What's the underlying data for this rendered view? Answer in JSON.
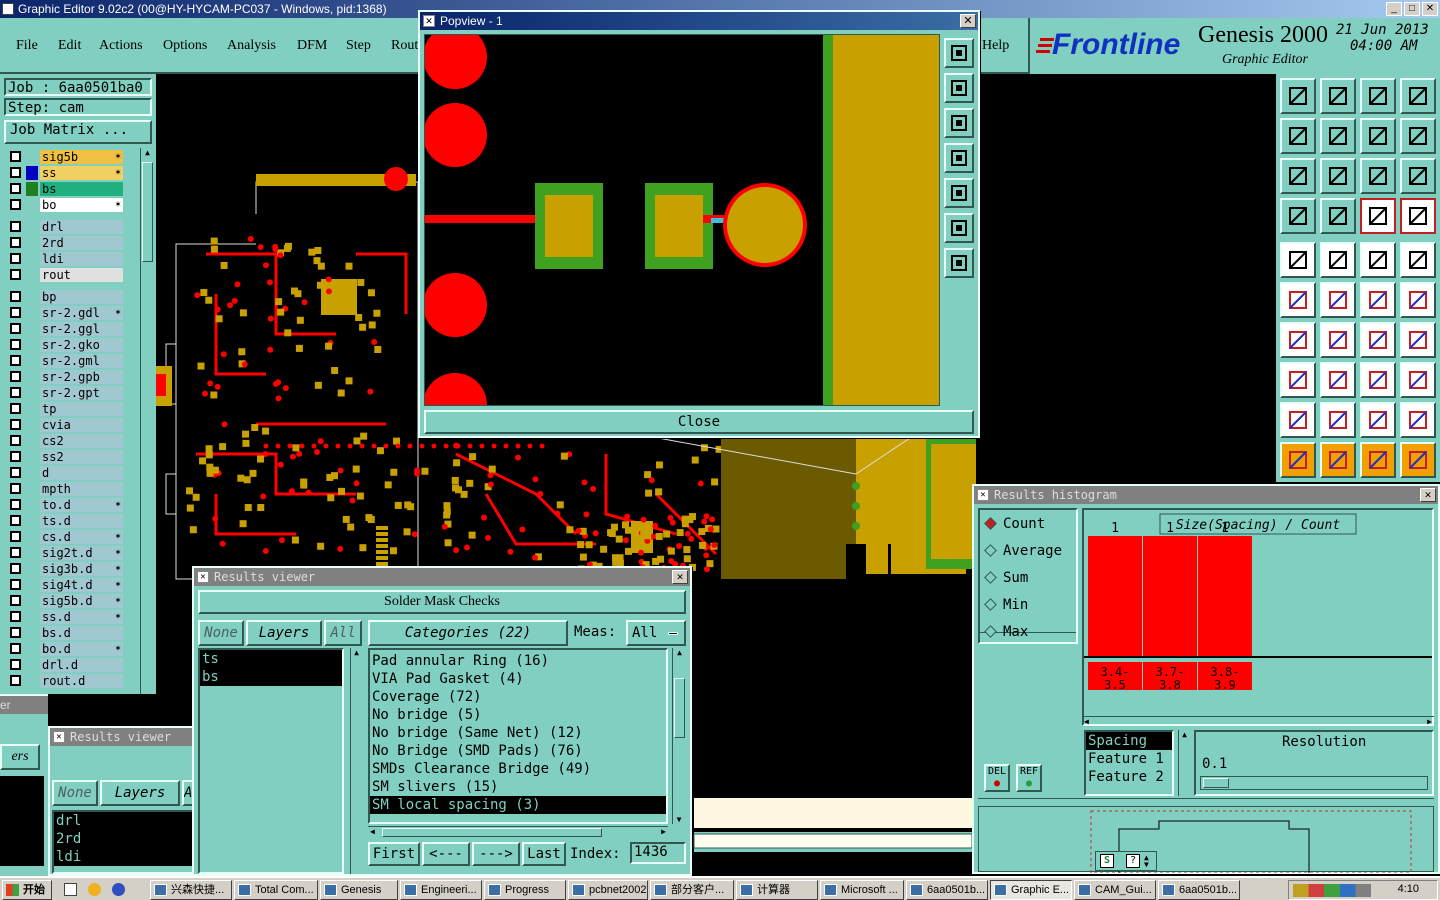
{
  "window": {
    "title": "Graphic Editor 9.02c2 (00@HY-HYCAM-PC037 - Windows, pid:1368)"
  },
  "menu": [
    "File",
    "Edit",
    "Actions",
    "Options",
    "Analysis",
    "DFM",
    "Step",
    "Rout"
  ],
  "menu_help": "Help",
  "brand": {
    "company": "Frontline",
    "product": "Genesis 2000",
    "subtitle": "Graphic Editor",
    "date": "21 Jun 2013",
    "time": "04:00 AM"
  },
  "job": {
    "job_label": "Job : 6aa0501ba0",
    "step_label": "Step: cam",
    "matrix_button": "Job Matrix ..."
  },
  "layers": [
    {
      "name": "sig5b",
      "color": "#f0c040",
      "mark": "✶"
    },
    {
      "name": "ss",
      "color": "#f0d060",
      "mark": "✶"
    },
    {
      "name": "bs",
      "color": "#20b080",
      "mark": ""
    },
    {
      "name": "bo",
      "color": "#ffffff",
      "mark": "✶"
    },
    {
      "name": "drl",
      "color": "#a0c8d0",
      "mark": ""
    },
    {
      "name": "2rd",
      "color": "#a0c8d0",
      "mark": ""
    },
    {
      "name": "ldi",
      "color": "#a0c8d0",
      "mark": ""
    },
    {
      "name": "rout",
      "color": "#e0e0e0",
      "mark": ""
    },
    {
      "name": "bp",
      "color": "#a0c8d0",
      "mark": ""
    },
    {
      "name": "sr-2.gdl",
      "color": "#a0c8d0",
      "mark": "✶"
    },
    {
      "name": "sr-2.ggl",
      "color": "#a0c8d0",
      "mark": ""
    },
    {
      "name": "sr-2.gko",
      "color": "#a0c8d0",
      "mark": ""
    },
    {
      "name": "sr-2.gml",
      "color": "#a0c8d0",
      "mark": ""
    },
    {
      "name": "sr-2.gpb",
      "color": "#a0c8d0",
      "mark": ""
    },
    {
      "name": "sr-2.gpt",
      "color": "#a0c8d0",
      "mark": ""
    },
    {
      "name": "tp",
      "color": "#a0c8d0",
      "mark": ""
    },
    {
      "name": "cvia",
      "color": "#a0c8d0",
      "mark": ""
    },
    {
      "name": "cs2",
      "color": "#a0c8d0",
      "mark": ""
    },
    {
      "name": "ss2",
      "color": "#a0c8d0",
      "mark": ""
    },
    {
      "name": "d",
      "color": "#a0c8d0",
      "mark": ""
    },
    {
      "name": "mpth",
      "color": "#a0c8d0",
      "mark": ""
    },
    {
      "name": "to.d",
      "color": "#a0c8d0",
      "mark": "✶"
    },
    {
      "name": "ts.d",
      "color": "#a0c8d0",
      "mark": ""
    },
    {
      "name": "cs.d",
      "color": "#a0c8d0",
      "mark": "✶"
    },
    {
      "name": "sig2t.d",
      "color": "#a0c8d0",
      "mark": "✶"
    },
    {
      "name": "sig3b.d",
      "color": "#a0c8d0",
      "mark": "✶"
    },
    {
      "name": "sig4t.d",
      "color": "#a0c8d0",
      "mark": "✶"
    },
    {
      "name": "sig5b.d",
      "color": "#a0c8d0",
      "mark": "✶"
    },
    {
      "name": "ss.d",
      "color": "#a0c8d0",
      "mark": "✶"
    },
    {
      "name": "bs.d",
      "color": "#a0c8d0",
      "mark": ""
    },
    {
      "name": "bo.d",
      "color": "#a0c8d0",
      "mark": "✶"
    },
    {
      "name": "drl.d",
      "color": "#a0c8d0",
      "mark": ""
    },
    {
      "name": "rout.d",
      "color": "#a0c8d0",
      "mark": ""
    }
  ],
  "popview": {
    "title": "Popview - 1",
    "close": "Close"
  },
  "results_viewer": {
    "title": "Results viewer",
    "heading": "Solder Mask Checks",
    "none": "None",
    "layers": "Layers",
    "all": "All",
    "categories_label": "Categories (22)",
    "meas_label": "Meas:",
    "meas_value": "All",
    "layer_list": [
      "ts",
      "bs"
    ],
    "categories": [
      "Pad annular Ring (16)",
      "VIA Pad Gasket (4)",
      "Coverage (72)",
      "No bridge (5)",
      "No bridge (Same Net) (12)",
      "No Bridge (SMD Pads) (76)",
      "SMDs Clearance Bridge (49)",
      "SM slivers (15)",
      "SM local spacing (3)"
    ],
    "nav": {
      "first": "First",
      "prev": "<---",
      "next": "--->",
      "last": "Last",
      "index_label": "Index:",
      "index_value": "1436"
    }
  },
  "results_viewer2": {
    "title": "Results viewer",
    "none": "None",
    "layers": "Layers",
    "a": "A",
    "list": [
      "drl",
      "2rd",
      "ldi"
    ],
    "left_label": "ers",
    "left_title": "er"
  },
  "histogram": {
    "title": "Results histogram",
    "modes": [
      "Count",
      "Average",
      "Sum",
      "Min",
      "Max"
    ],
    "header": "Size(Spacing) / Count",
    "del": "DEL",
    "ref": "REF",
    "fields": [
      "Spacing",
      "Feature 1",
      "Feature 2"
    ],
    "resolution_label": "Resolution",
    "resolution_value": "0.1"
  },
  "chart_data": {
    "type": "bar",
    "title": "Size(Spacing) / Count",
    "categories": [
      "3.4-3.5",
      "3.7-3.8",
      "3.8-3.9"
    ],
    "values": [
      1,
      1,
      1
    ]
  },
  "taskbar": {
    "start": "开始",
    "clock": "4:10",
    "tasks": [
      "兴森快捷...",
      "Total Com...",
      "Genesis",
      "Engineeri...",
      "Progress",
      "pcbnet2002",
      "部分客户...",
      "计算器",
      "Microsoft ...",
      "6aa0501b...",
      "Graphic E...",
      "CAM_Gui...",
      "6aa0501b..."
    ]
  },
  "colors": {
    "panel": "#80cfc0",
    "copper": "#c8a000",
    "mask": "#ff0000",
    "green": "#40a020"
  }
}
